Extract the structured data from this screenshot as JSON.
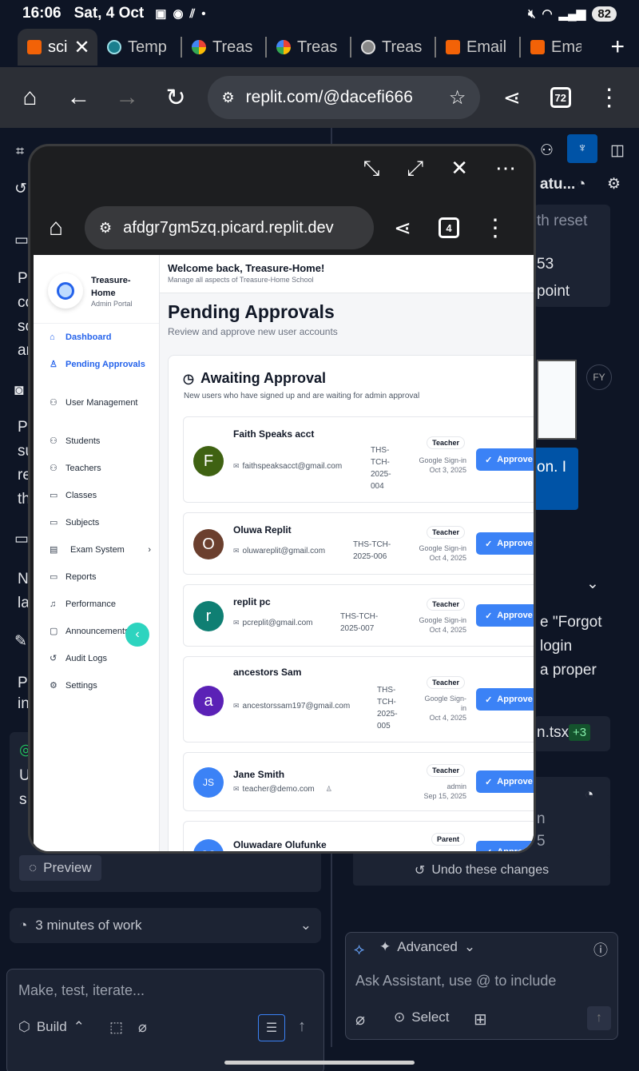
{
  "status_bar": {
    "time": "16:06",
    "date": "Sat, 4 Oct",
    "battery": "82"
  },
  "browser": {
    "tabs": [
      {
        "label": "sci",
        "favicon": "replit",
        "active": true
      },
      {
        "label": "Temp",
        "favicon": "temp"
      },
      {
        "label": "Treas",
        "favicon": "google"
      },
      {
        "label": "Treas",
        "favicon": "google"
      },
      {
        "label": "Treas",
        "favicon": "globe"
      },
      {
        "label": "Email",
        "favicon": "replit"
      },
      {
        "label": "Ema",
        "favicon": "replit"
      }
    ],
    "url": "replit.com/@dacefi666",
    "tab_count": "72"
  },
  "background": {
    "left_text": [
      "Po",
      "co",
      "so",
      "ar",
      "Po",
      "su",
      "re",
      "th",
      "N",
      "la",
      "Po",
      "in",
      "U",
      "s"
    ],
    "right_fragments": [
      "atu...",
      "th reset",
      "53",
      "point",
      "FY",
      "on. I",
      "e \"Forgot",
      "login",
      "a proper",
      "n.tsx",
      "+3",
      "n",
      "5"
    ],
    "undo_label": "Undo these changes",
    "preview_label": "Preview",
    "progress_label": "3 minutes of work",
    "left_composer_placeholder": "Make, test, iterate...",
    "build_label": "Build",
    "advanced_label": "Advanced",
    "right_composer_placeholder": "Ask Assistant, use @ to include",
    "select_label": "Select"
  },
  "popup": {
    "url": "afdgr7gm5zq.picard.replit.dev",
    "tab_count": "4"
  },
  "app": {
    "brand_name": "Treasure-Home",
    "brand_sub": "Admin Portal",
    "nav": [
      {
        "label": "Dashboard",
        "icon": "home-icon",
        "active": true
      },
      {
        "label": "Pending Approvals",
        "icon": "user-check-icon",
        "active": true
      },
      {
        "label": "User Management",
        "icon": "users-icon"
      },
      {
        "label": "Students",
        "icon": "users-icon"
      },
      {
        "label": "Teachers",
        "icon": "users-icon"
      },
      {
        "label": "Classes",
        "icon": "book-icon"
      },
      {
        "label": "Subjects",
        "icon": "book-icon"
      },
      {
        "label": "Exam System",
        "icon": "clipboard-icon",
        "has_chevron": true
      },
      {
        "label": "Reports",
        "icon": "book-icon"
      },
      {
        "label": "Performance",
        "icon": "bell-icon"
      },
      {
        "label": "Announcements",
        "icon": "message-icon"
      },
      {
        "label": "Audit Logs",
        "icon": "history-icon"
      },
      {
        "label": "Settings",
        "icon": "gear-icon"
      }
    ],
    "welcome": "Welcome back, Treasure-Home!",
    "welcome_sub": "Manage all aspects of Treasure-Home School",
    "page_title": "Pending Approvals",
    "page_sub": "Review and approve new user accounts",
    "card_title": "Awaiting Approval",
    "card_sub": "New users who have signed up and are waiting for admin approval",
    "approve_label": "Approve",
    "users": [
      {
        "name": "Faith Speaks acct",
        "email": "faithspeaksacct@gmail.com",
        "code": "THS-TCH-2025-004",
        "role": "Teacher",
        "method": "Google Sign-in",
        "date": "Oct 3, 2025",
        "initial": "F",
        "color": "#3f6212"
      },
      {
        "name": "Oluwa Replit",
        "email": "oluwareplit@gmail.com",
        "code": "THS-TCH-2025-006",
        "role": "Teacher",
        "method": "Google Sign-in",
        "date": "Oct 4, 2025",
        "initial": "O",
        "color": "#6b3f2e"
      },
      {
        "name": "replit pc",
        "email": "pcreplit@gmail.com",
        "code": "THS-TCH-2025-007",
        "role": "Teacher",
        "method": "Google Sign-in",
        "date": "Oct 4, 2025",
        "initial": "r",
        "color": "#0f7f73"
      },
      {
        "name": "ancestors Sam",
        "email": "ancestorssam197@gmail.com",
        "code": "THS-TCH-2025-005",
        "role": "Teacher",
        "method": "Google Sign-in",
        "date": "Oct 4, 2025",
        "initial": "a",
        "color": "#5b21b6"
      },
      {
        "name": "Jane Smith",
        "email": "teacher@demo.com",
        "code": "",
        "role": "Teacher",
        "method": "admin",
        "date": "Sep 15, 2025",
        "initial": "JS",
        "color": "#3b82f6"
      },
      {
        "name": "Oluwadare Olufunke",
        "email": "",
        "code": "",
        "role": "Parent",
        "method": "",
        "date": "",
        "initial": "OO",
        "color": "#3b82f6"
      }
    ]
  }
}
